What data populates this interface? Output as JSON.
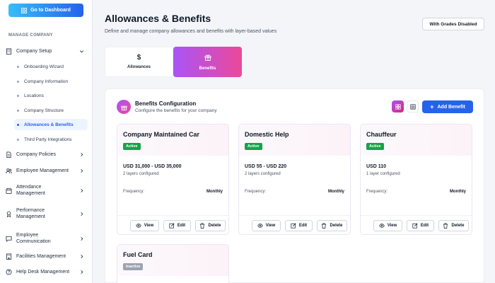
{
  "sidebar": {
    "dashboard_button": "Go to Dashboard",
    "section_label": "MANAGE COMPANY",
    "company_setup": "Company Setup",
    "sub_items": [
      "Onboarding Wizard",
      "Company Information",
      "Locations",
      "Company Structure",
      "Allowances & Benefits",
      "Third Party Integrations"
    ],
    "items": [
      {
        "label": "Company Policies",
        "icon": "document-icon"
      },
      {
        "label": "Employee Management",
        "icon": "users-icon"
      },
      {
        "label": "Attendance Management",
        "icon": "calendar-icon"
      },
      {
        "label": "Performance Management",
        "icon": "award-icon"
      },
      {
        "label": "Employee Communication",
        "icon": "message-icon"
      },
      {
        "label": "Facilities Management",
        "icon": "building-icon"
      },
      {
        "label": "Help Desk Management",
        "icon": "help-icon"
      }
    ]
  },
  "header": {
    "title": "Allowances & Benefits",
    "subtitle": "Define and manage company allowances and benefits with layer-based values",
    "grades_button": "With Grades Disabled"
  },
  "tabs": [
    {
      "label": "Allowances",
      "icon": "$"
    },
    {
      "label": "Benefits",
      "icon": "gift-icon"
    }
  ],
  "config": {
    "title": "Benefits Configuration",
    "subtitle": "Configure the benefits for your company",
    "add_button": "Add Benefit"
  },
  "cards": [
    {
      "name": "Company Maintained Car",
      "status": "Active",
      "range": "USD 31,000 - USD 35,000",
      "layers": "2 layers configured",
      "frequency_label": "Frequency:",
      "frequency": "Monthly"
    },
    {
      "name": "Domestic Help",
      "status": "Active",
      "range": "USD 55 - USD 220",
      "layers": "2 layers configured",
      "frequency_label": "Frequency:",
      "frequency": "Monthly"
    },
    {
      "name": "Chauffeur",
      "status": "Active",
      "range": "USD 110",
      "layers": "1 layer configured",
      "frequency_label": "Frequency:",
      "frequency": "Monthly"
    },
    {
      "name": "Fuel Card",
      "status": "Inactive"
    }
  ],
  "actions": {
    "view": "View",
    "edit": "Edit",
    "delete": "Delete"
  },
  "colors": {
    "accent": "#2563eb",
    "brand_gradient_start": "#a855f7",
    "brand_gradient_end": "#ec4899",
    "active": "#16a34a",
    "inactive": "#9ca3af"
  }
}
